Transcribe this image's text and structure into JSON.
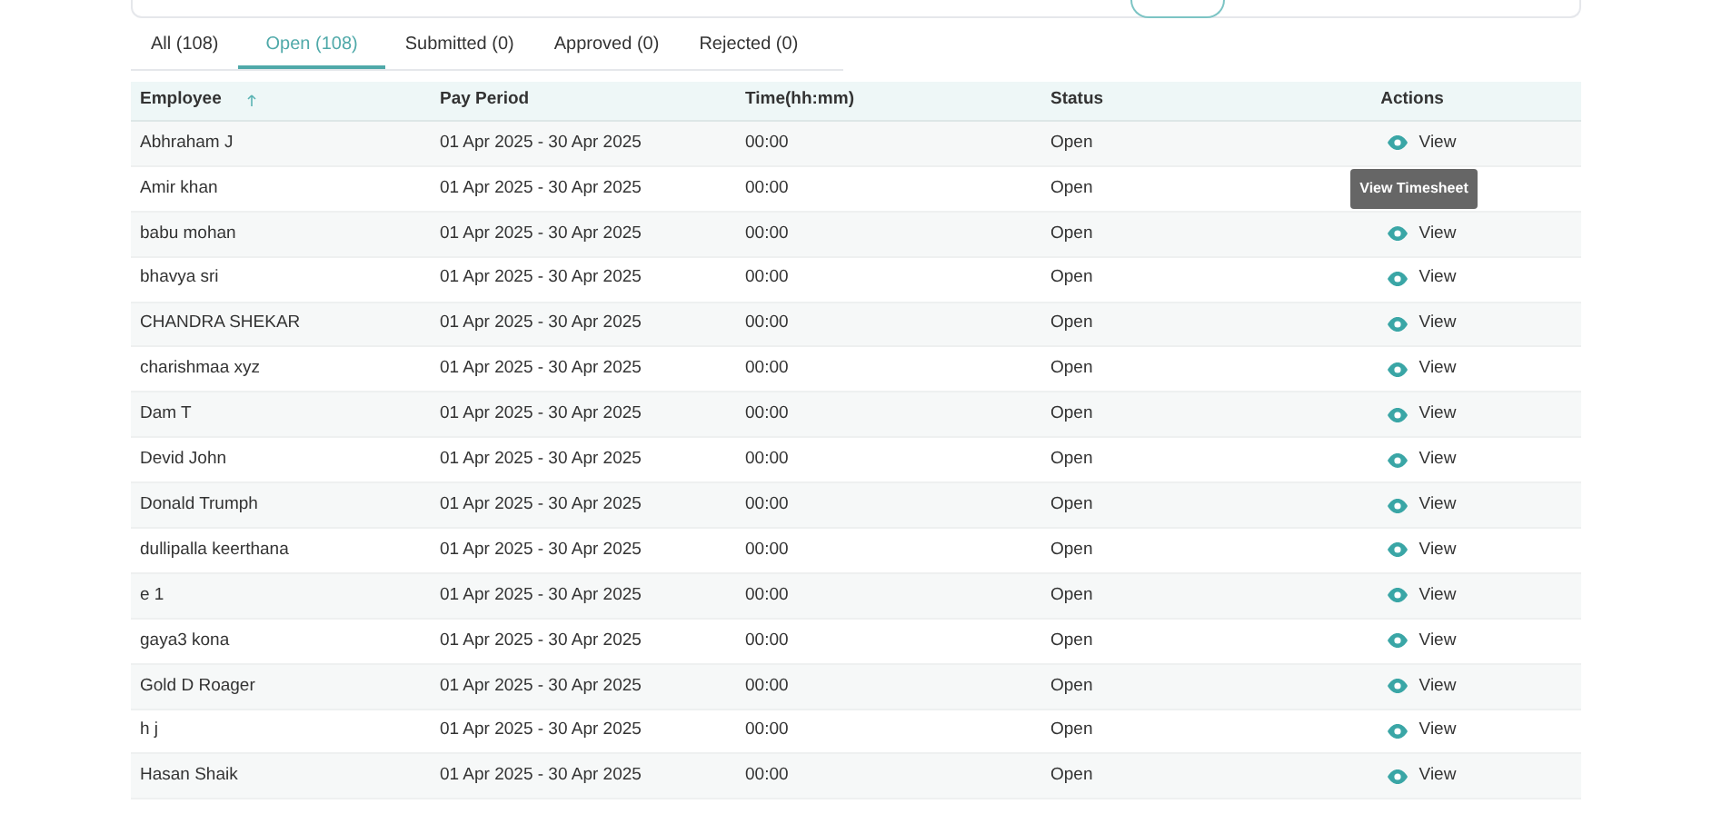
{
  "tabs": [
    {
      "label": "All (108)",
      "selected": false
    },
    {
      "label": "Open (108)",
      "selected": true
    },
    {
      "label": "Submitted (0)",
      "selected": false
    },
    {
      "label": "Approved (0)",
      "selected": false
    },
    {
      "label": "Rejected (0)",
      "selected": false
    }
  ],
  "table": {
    "columns": [
      {
        "label": "Employee",
        "sorted_ascending": true
      },
      {
        "label": "Pay Period"
      },
      {
        "label": "Time(hh:mm)"
      },
      {
        "label": "Status"
      },
      {
        "label": "Actions"
      }
    ],
    "rows": [
      {
        "employee": "Abhraham J",
        "pay_period": "01 Apr 2025 - 30 Apr 2025",
        "time": "00:00",
        "status": "Open",
        "action": "View"
      },
      {
        "employee": "Amir khan",
        "pay_period": "01 Apr 2025 - 30 Apr 2025",
        "time": "00:00",
        "status": "Open",
        "tooltip": "View Timesheet"
      },
      {
        "employee": "babu mohan",
        "pay_period": "01 Apr 2025 - 30 Apr 2025",
        "time": "00:00",
        "status": "Open",
        "action": "View"
      },
      {
        "employee": "bhavya sri",
        "pay_period": "01 Apr 2025 - 30 Apr 2025",
        "time": "00:00",
        "status": "Open",
        "action": "View"
      },
      {
        "employee": "CHANDRA SHEKAR",
        "pay_period": "01 Apr 2025 - 30 Apr 2025",
        "time": "00:00",
        "status": "Open",
        "action": "View"
      },
      {
        "employee": "charishmaa xyz",
        "pay_period": "01 Apr 2025 - 30 Apr 2025",
        "time": "00:00",
        "status": "Open",
        "action": "View"
      },
      {
        "employee": "Dam T",
        "pay_period": "01 Apr 2025 - 30 Apr 2025",
        "time": "00:00",
        "status": "Open",
        "action": "View"
      },
      {
        "employee": "Devid John",
        "pay_period": "01 Apr 2025 - 30 Apr 2025",
        "time": "00:00",
        "status": "Open",
        "action": "View"
      },
      {
        "employee": "Donald Trumph",
        "pay_period": "01 Apr 2025 - 30 Apr 2025",
        "time": "00:00",
        "status": "Open",
        "action": "View"
      },
      {
        "employee": "dullipalla keerthana",
        "pay_period": "01 Apr 2025 - 30 Apr 2025",
        "time": "00:00",
        "status": "Open",
        "action": "View"
      },
      {
        "employee": "e 1",
        "pay_period": "01 Apr 2025 - 30 Apr 2025",
        "time": "00:00",
        "status": "Open",
        "action": "View"
      },
      {
        "employee": "gaya3 kona",
        "pay_period": "01 Apr 2025 - 30 Apr 2025",
        "time": "00:00",
        "status": "Open",
        "action": "View"
      },
      {
        "employee": "Gold D Roager",
        "pay_period": "01 Apr 2025 - 30 Apr 2025",
        "time": "00:00",
        "status": "Open",
        "action": "View"
      },
      {
        "employee": "h j",
        "pay_period": "01 Apr 2025 - 30 Apr 2025",
        "time": "00:00",
        "status": "Open",
        "action": "View"
      },
      {
        "employee": "Hasan Shaik",
        "pay_period": "01 Apr 2025 - 30 Apr 2025",
        "time": "00:00",
        "status": "Open",
        "action": "View"
      }
    ]
  }
}
